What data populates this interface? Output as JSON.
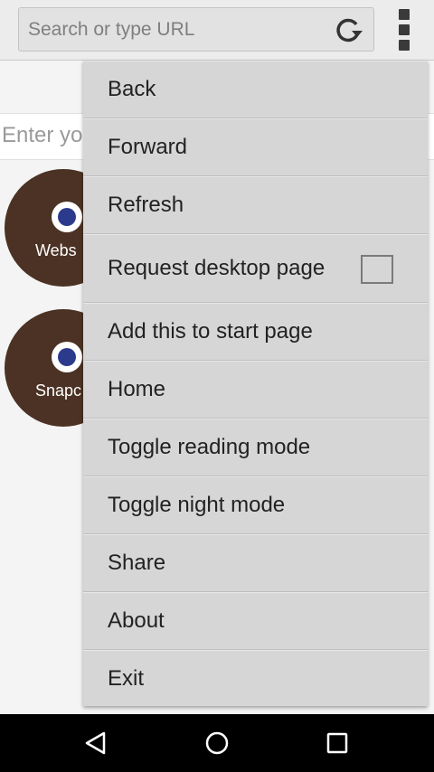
{
  "toolbar": {
    "url_placeholder": "Search or type URL",
    "reload_icon": "reload-icon",
    "overflow_icon": "overflow-menu-icon"
  },
  "page": {
    "search_placeholder": "Enter yo",
    "tiles": [
      {
        "label": "Webs",
        "icon": "globe-icon"
      },
      {
        "label": "Snapc",
        "icon": "globe-icon"
      }
    ]
  },
  "menu": {
    "items": [
      {
        "label": "Back"
      },
      {
        "label": "Forward"
      },
      {
        "label": "Refresh"
      },
      {
        "label": "Request desktop page",
        "checkbox": false
      },
      {
        "label": "Add this to start page"
      },
      {
        "label": "Home"
      },
      {
        "label": "Toggle reading mode"
      },
      {
        "label": "Toggle night mode"
      },
      {
        "label": "Share"
      },
      {
        "label": "About"
      },
      {
        "label": "Exit"
      }
    ]
  },
  "navbar": {
    "back_icon": "back-triangle-icon",
    "home_icon": "home-circle-icon",
    "recents_icon": "recents-square-icon"
  },
  "colors": {
    "tile_bg": "#4b3224",
    "menu_bg": "#d6d6d6",
    "navbar_bg": "#000000"
  }
}
